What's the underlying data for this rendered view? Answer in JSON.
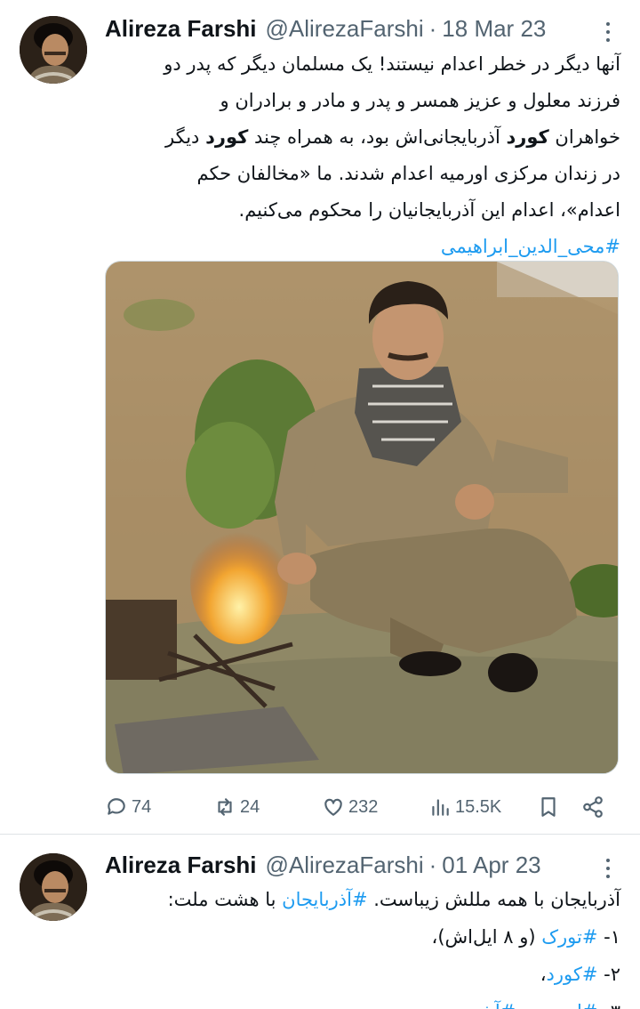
{
  "tweets": [
    {
      "author": {
        "name": "Alireza Farshi",
        "handle": "@AlirezaFarshi"
      },
      "date": "18 Mar 23",
      "separator": "·",
      "lines": [
        "آنها دیگر در خطر اعدام نیستند! یک مسلمان دیگر که پدر دو",
        "فرزند معلول و عزیز همسر و پدر و مادر و برادران و",
        {
          "pre": "خواهران ",
          "bold": "کورد",
          "post": " آذربایجانی‌اش بود، به همراه چند ",
          "bold2": "کورد",
          "post2": " دیگر"
        },
        "در زندان مرکزی اورمیه اعدام شدند. ما «مخالفان حکم",
        "اعدام»، اعدام این آذربایجانیان را محکوم می‌کنیم."
      ],
      "hashtag": "#محی_الدین_ابراهیمی",
      "stats": {
        "replies": "74",
        "retweets": "24",
        "likes": "232",
        "views": "15.5K"
      }
    },
    {
      "author": {
        "name": "Alireza Farshi",
        "handle": "@AlirezaFarshi"
      },
      "date": "01 Apr 23",
      "separator": "·",
      "line1_pre": "آذربایجان با همه مللش زیباست. ",
      "line1_tag": "#آذربایجان",
      "line1_post": " با هشت ملت:",
      "items": [
        {
          "num": "۱- ",
          "tag": "#تورک",
          "rest": " (و ۸ ایل‌اش)،"
        },
        {
          "num": "۲- ",
          "tag": "#کورد",
          "rest": "،"
        },
        {
          "num": "۳- ",
          "tag": "#ارمنی",
          "mid": " و ",
          "tag2": "#آشوری",
          "rest": "،"
        }
      ]
    }
  ],
  "icons": [
    "reply-icon",
    "retweet-icon",
    "like-icon",
    "views-icon",
    "bookmark-icon",
    "share-icon",
    "more-icon"
  ],
  "colors": {
    "link": "#1d9bf0",
    "muted": "#536471",
    "text": "#0f1419",
    "divider": "#dfe3e6"
  }
}
